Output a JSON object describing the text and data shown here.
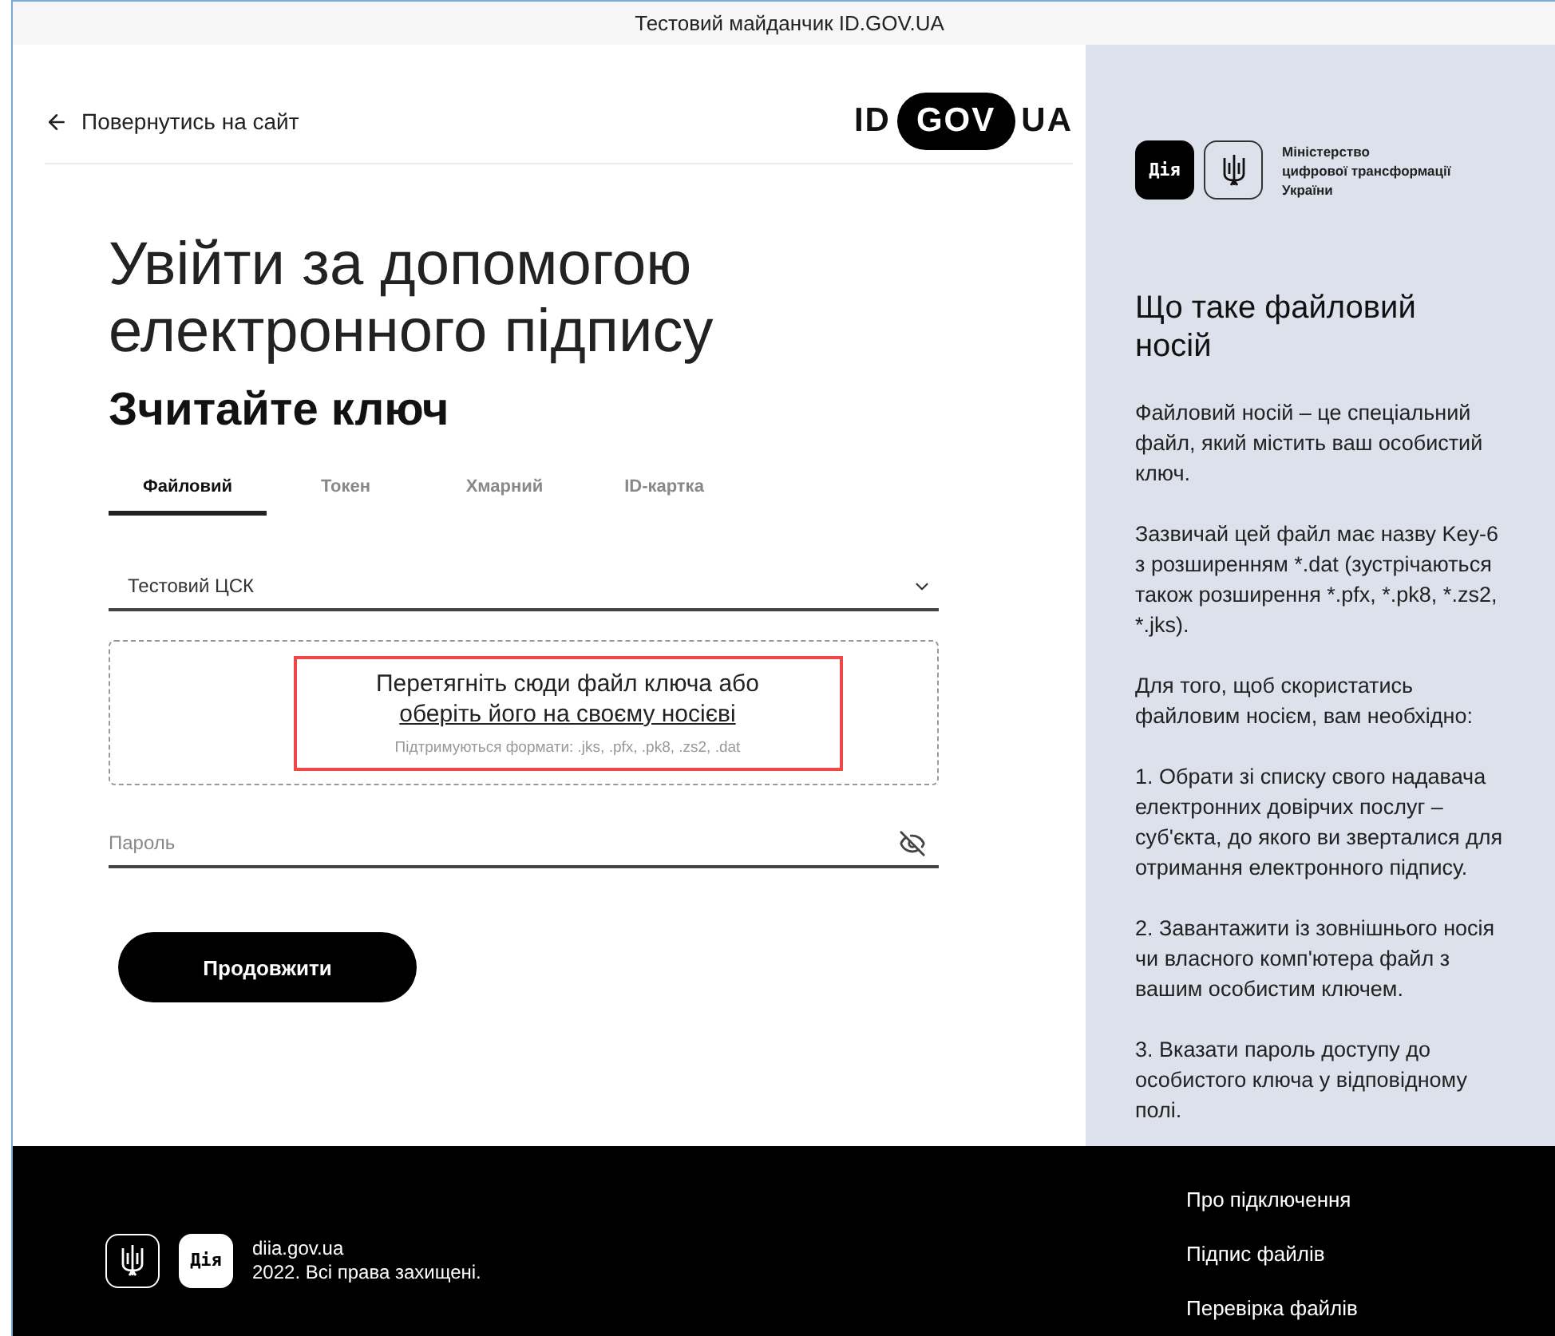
{
  "banner": {
    "title": "Тестовий майданчик ID.GOV.UA"
  },
  "header": {
    "back_link": "Повернутись на сайт",
    "logo": {
      "left": "ID",
      "middle": "GOV",
      "right": "UA"
    }
  },
  "title": "Увійти за допомогою електронного підпису",
  "subtitle": "Зчитайте ключ",
  "tabs": [
    {
      "label": "Файловий",
      "selected": true
    },
    {
      "label": "Токен",
      "selected": false
    },
    {
      "label": "Хмарний",
      "selected": false
    },
    {
      "label": "ID-картка",
      "selected": false
    }
  ],
  "provider_select": {
    "value": "Тестовий ЦСК"
  },
  "dropzone": {
    "text": "Перетягніть сюди файл ключа або",
    "link": "оберіть його на своєму носієві",
    "formats": "Підтримуються формати: .jks, .pfx, .pk8, .zs2, .dat",
    "highlighted": true
  },
  "password": {
    "placeholder": "Пароль",
    "visible": false
  },
  "submit_button": "Продовжити",
  "info_panel": {
    "badge": "Дія",
    "ministry": [
      "Міністерство",
      "цифрової трансформації",
      "України"
    ],
    "heading": "Що таке файловий носій",
    "paragraphs": [
      "Файловий носій – це спеціальний файл, який містить ваш особистий ключ.",
      "Зазвичай цей файл має назву Key-6 з розширенням *.dat (зустрічаються також розширення *.pfx, *.pk8, *.zs2, *.jks).",
      "Для того, щоб скористатись файловим носієм, вам необхідно:",
      "1. Обрати зі списку свого надавача електронних довірчих послуг – суб'єкта, до якого ви зверталися для отримання електронного підпису.",
      "2. Завантажити із зовнішнього носія чи власного комп'ютера файл з вашим особистим ключем.",
      "3. Вказати пароль доступу до особистого ключа у відповідному полі."
    ]
  },
  "footer": {
    "badge": "Дія",
    "site": "diia.gov.ua",
    "copyright": "2022. Всі права захищені.",
    "links": [
      "Про підключення",
      "Підпис файлів",
      "Перевірка файлів"
    ]
  }
}
